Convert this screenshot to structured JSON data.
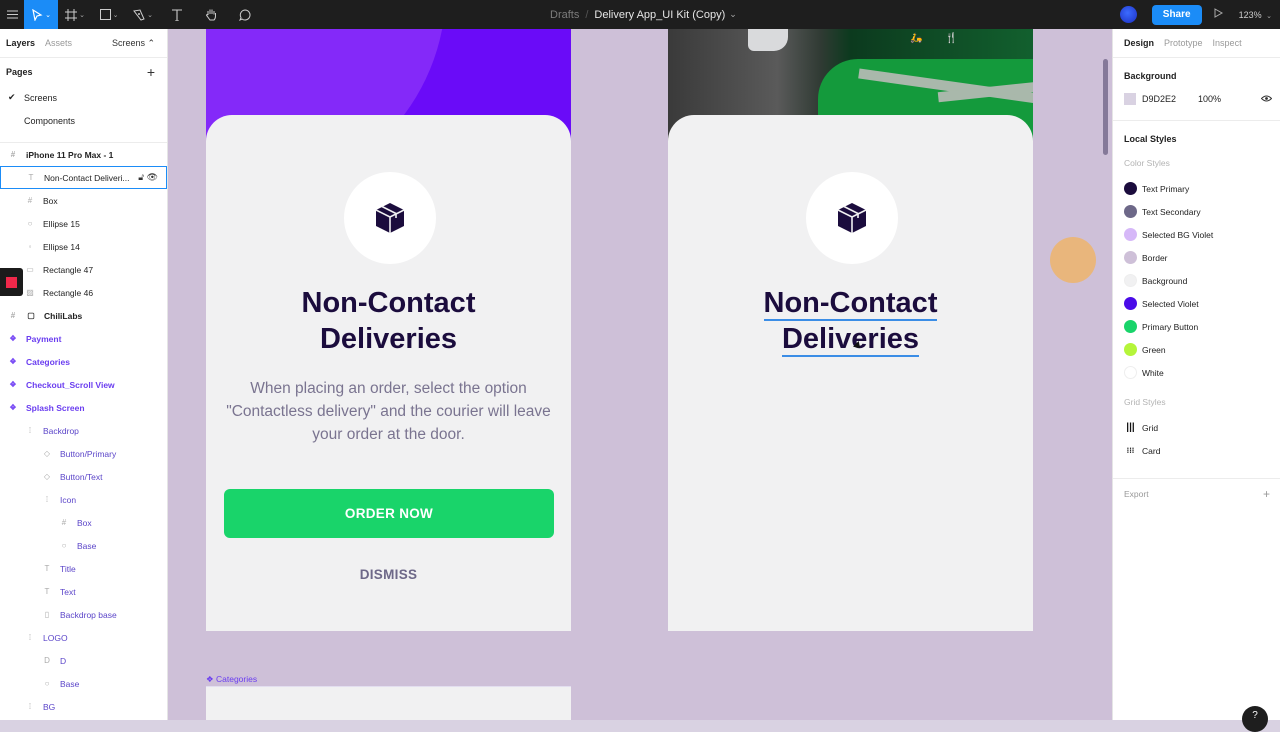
{
  "toolbar": {
    "menu_icon": "hamburger-icon",
    "tools": [
      "move",
      "frame",
      "shape",
      "pen",
      "text",
      "hand",
      "comment"
    ],
    "breadcrumb_parent": "Drafts",
    "breadcrumb_sep": "/",
    "file_name": "Delivery App_UI Kit (Copy)",
    "file_caret": "⌄",
    "share_label": "Share",
    "zoom_level": "123%"
  },
  "left_panel": {
    "tabs": [
      "Layers",
      "Assets"
    ],
    "page_selector": "Screens ⌃",
    "pages_title": "Pages",
    "pages": [
      {
        "label": "Screens",
        "current": true
      },
      {
        "label": "Components",
        "current": false
      }
    ],
    "layers": [
      {
        "label": "iPhone 11 Pro Max - 1",
        "icon": "#",
        "type": "frame",
        "indent": 0
      },
      {
        "label": "Non-Contact Deliveri...",
        "icon": "T",
        "type": "text",
        "indent": 1,
        "selected": true
      },
      {
        "label": "Box",
        "icon": "#",
        "type": "frame",
        "indent": 1
      },
      {
        "label": "Ellipse 15",
        "icon": "○",
        "type": "ellipse",
        "indent": 1
      },
      {
        "label": "Ellipse 14",
        "icon": "◦",
        "type": "ellipse",
        "indent": 1
      },
      {
        "label": "Rectangle 47",
        "icon": "▭",
        "type": "rect",
        "indent": 1
      },
      {
        "label": "Rectangle 46",
        "icon": "▨",
        "type": "image",
        "indent": 1
      },
      {
        "label": "ChiliLabs",
        "icon": "#",
        "type": "frame",
        "indent": 0
      },
      {
        "label": "Payment",
        "icon": "❖",
        "type": "component",
        "indent": 0
      },
      {
        "label": "Categories",
        "icon": "❖",
        "type": "component",
        "indent": 0
      },
      {
        "label": "Checkout_Scroll View",
        "icon": "❖",
        "type": "component",
        "indent": 0
      },
      {
        "label": "Splash Screen",
        "icon": "❖",
        "type": "component",
        "indent": 0
      },
      {
        "label": "Backdrop",
        "icon": "⁞",
        "type": "instance",
        "indent": 1
      },
      {
        "label": "Button/Primary",
        "icon": "◇",
        "type": "instance",
        "indent": 2
      },
      {
        "label": "Button/Text",
        "icon": "◇",
        "type": "instance",
        "indent": 2
      },
      {
        "label": "Icon",
        "icon": "⁞",
        "type": "instance",
        "indent": 2
      },
      {
        "label": "Box",
        "icon": "#",
        "type": "instance",
        "indent": 3
      },
      {
        "label": "Base",
        "icon": "○",
        "type": "instance",
        "indent": 3
      },
      {
        "label": "Title",
        "icon": "T",
        "type": "instance",
        "indent": 2
      },
      {
        "label": "Text",
        "icon": "T",
        "type": "instance",
        "indent": 2
      },
      {
        "label": "Backdrop base",
        "icon": "▯",
        "type": "instance",
        "indent": 2
      },
      {
        "label": "LOGO",
        "icon": "⁞",
        "type": "instance",
        "indent": 1
      },
      {
        "label": "D",
        "icon": "D",
        "type": "instance",
        "indent": 2
      },
      {
        "label": "Base",
        "icon": "○",
        "type": "instance",
        "indent": 2
      },
      {
        "label": "BG",
        "icon": "⁞",
        "type": "instance",
        "indent": 1
      }
    ]
  },
  "canvas": {
    "background": "#CEC0D8",
    "screen1": {
      "title_line1": "Non-Contact",
      "title_line2": "Deliveries",
      "description": "When placing an order, select the option \"Contactless delivery\" and the courier will leave your order at the door.",
      "order_button": "ORDER NOW",
      "dismiss_button": "DISMISS"
    },
    "screen2": {
      "title_line1": "Non-Contact ",
      "title_line2": "Deliveries",
      "hero_icons": "🛵 🍴"
    },
    "categories_frame_label": "Categories"
  },
  "right_panel": {
    "tabs": [
      "Design",
      "Prototype",
      "Inspect"
    ],
    "background_title": "Background",
    "background_hex": "D9D2E2",
    "background_opacity": "100%",
    "local_styles_title": "Local Styles",
    "color_styles_title": "Color Styles",
    "color_styles": [
      {
        "label": "Text Primary",
        "color": "#1B0C3D"
      },
      {
        "label": "Text Secondary",
        "color": "#6D6888"
      },
      {
        "label": "Selected BG Violet",
        "color": "#D6B8F8"
      },
      {
        "label": "Border",
        "color": "#CEC0D8"
      },
      {
        "label": "Background",
        "color": "#F1F1F2"
      },
      {
        "label": "Selected Violet",
        "color": "#4A0BE8"
      },
      {
        "label": "Primary Button",
        "color": "#19D46A"
      },
      {
        "label": "Green",
        "color": "#B5F53A"
      },
      {
        "label": "White",
        "color": "#FFFFFF"
      }
    ],
    "grid_styles_title": "Grid Styles",
    "grid_styles": [
      {
        "label": "Grid",
        "icon": "columns-grid-icon"
      },
      {
        "label": "Card",
        "icon": "dots-grid-icon"
      }
    ],
    "export_title": "Export"
  },
  "help_label": "?"
}
